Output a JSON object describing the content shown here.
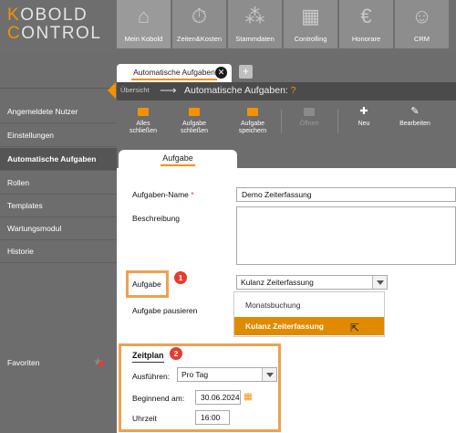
{
  "logo": {
    "line1_first": "K",
    "line1_rest": "OBOLD",
    "line2_first": "C",
    "line2_rest": "ONTROL"
  },
  "nav": [
    {
      "label": "Mein Kobold",
      "icon": "home-icon"
    },
    {
      "label": "Zeiten&Kosten",
      "icon": "stopwatch-icon"
    },
    {
      "label": "Stammdaten",
      "icon": "org-chart-icon"
    },
    {
      "label": "Controlling",
      "icon": "calculator-icon"
    },
    {
      "label": "Honorare",
      "icon": "money-icon"
    },
    {
      "label": "CRM",
      "icon": "people-icon"
    }
  ],
  "sidebar": {
    "items": [
      {
        "label": "Angemeldete Nutzer"
      },
      {
        "label": "Einstellungen"
      },
      {
        "label": "Automatische Aufgaben"
      },
      {
        "label": "Rollen"
      },
      {
        "label": "Templates"
      },
      {
        "label": "Wartungsmodul"
      },
      {
        "label": "Historie"
      }
    ],
    "favorites_label": "Favoriten"
  },
  "tabs": {
    "active": "Automatische Aufgaben",
    "close": "✕",
    "add": "+"
  },
  "breadcrumb": {
    "home": "Übersicht",
    "arrow": "⟶",
    "title": "Automatische Aufgaben:",
    "help": "?"
  },
  "toolbar": {
    "close_all": [
      "Alles",
      "schließen"
    ],
    "close_task": [
      "Aufgabe",
      "schließen"
    ],
    "save_task": [
      "Aufgabe",
      "speichern"
    ],
    "open": "Öffnen",
    "new": "Neu",
    "edit": "Bearbeiten"
  },
  "content_tab": "Aufgabe",
  "form": {
    "name_label": "Aufgaben-Name",
    "name_required": "*",
    "name_value": "Demo Zeiterfassung",
    "description_label": "Beschreibung",
    "task_label": "Aufgabe",
    "task_value": "Kulanz Zeiterfassung",
    "task_options": [
      "Monatsbuchung",
      "Kulanz Zeiterfassung"
    ],
    "pause_label": "Aufgabe pausieren"
  },
  "schedule": {
    "title": "Zeitplan",
    "run_label": "Ausführen:",
    "run_value": "Pro Tag",
    "start_label": "Beginnend am:",
    "start_value": "30.06.2024",
    "time_label": "Uhrzeit",
    "time_value": "16:00"
  },
  "badges": {
    "one": "1",
    "two": "2"
  },
  "colors": {
    "accent": "#f39200",
    "badge": "#e63c2f",
    "highlight_box": "#f0a050"
  }
}
